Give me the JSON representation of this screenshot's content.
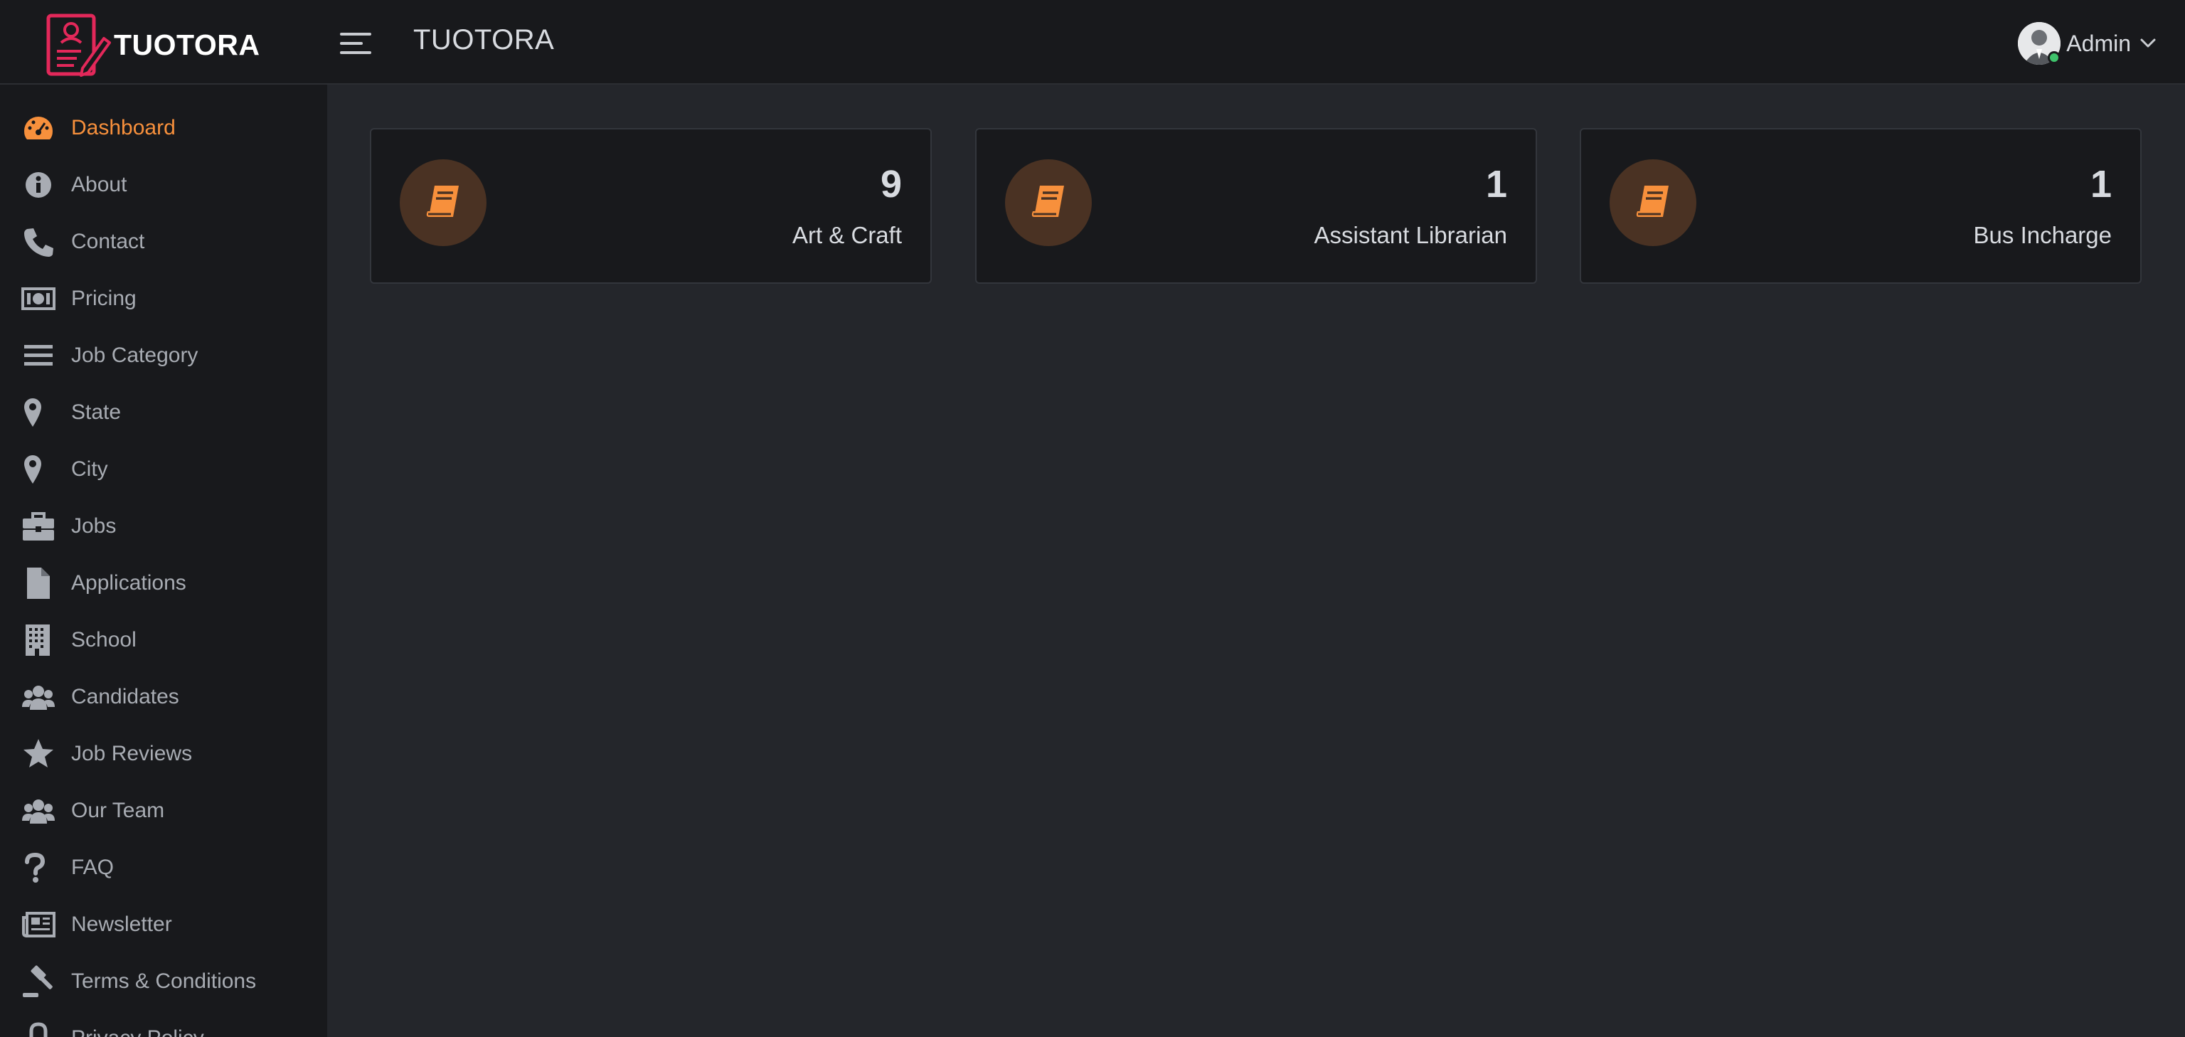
{
  "header": {
    "brand_name": "TUOTORA",
    "title": "TUOTORA",
    "user_name": "Admin",
    "logo_icon": "resume-pen-icon",
    "menu_icon": "hamburger-icon"
  },
  "colors": {
    "accent": "#f7903c",
    "brand": "#e3285a",
    "sidebar_bg": "#18191c",
    "content_bg": "#24262b",
    "online": "#3ec26b"
  },
  "sidebar": {
    "items": [
      {
        "label": "Dashboard",
        "icon": "gauge-icon",
        "active": true
      },
      {
        "label": "About",
        "icon": "info-circle-icon"
      },
      {
        "label": "Contact",
        "icon": "phone-icon"
      },
      {
        "label": "Pricing",
        "icon": "money-bill-icon"
      },
      {
        "label": "Job Category",
        "icon": "bars-icon"
      },
      {
        "label": "State",
        "icon": "map-marker-icon"
      },
      {
        "label": "City",
        "icon": "map-marker-icon"
      },
      {
        "label": "Jobs",
        "icon": "briefcase-icon"
      },
      {
        "label": "Applications",
        "icon": "file-icon"
      },
      {
        "label": "School",
        "icon": "building-icon"
      },
      {
        "label": "Candidates",
        "icon": "users-icon"
      },
      {
        "label": "Job Reviews",
        "icon": "star-icon"
      },
      {
        "label": "Our Team",
        "icon": "users-icon"
      },
      {
        "label": "FAQ",
        "icon": "question-icon"
      },
      {
        "label": "Newsletter",
        "icon": "newspaper-icon"
      },
      {
        "label": "Terms & Conditions",
        "icon": "gavel-icon"
      },
      {
        "label": "Privacy Policy",
        "icon": "lock-icon"
      }
    ]
  },
  "cards": [
    {
      "count": "9",
      "label": "Art & Craft",
      "icon": "book-icon"
    },
    {
      "count": "1",
      "label": "Assistant Librarian",
      "icon": "book-icon"
    },
    {
      "count": "1",
      "label": "Bus Incharge",
      "icon": "book-icon"
    }
  ]
}
